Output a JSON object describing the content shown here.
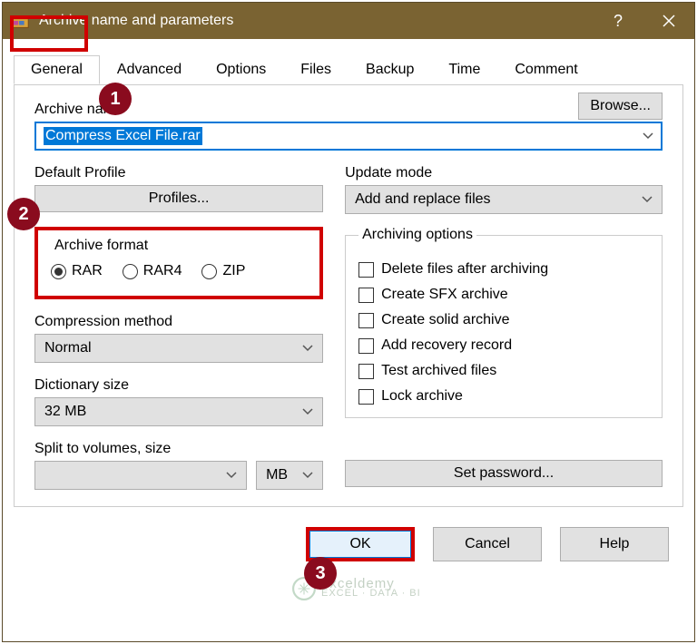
{
  "titlebar": {
    "title": "Archive name and parameters"
  },
  "tabs": [
    "General",
    "Advanced",
    "Options",
    "Files",
    "Backup",
    "Time",
    "Comment"
  ],
  "badges": {
    "b1": "1",
    "b2": "2",
    "b3": "3"
  },
  "general": {
    "archive_name_label": "Archive name",
    "browse": "Browse...",
    "filename": "Compress Excel File.rar",
    "default_profile_label": "Default Profile",
    "profiles_btn": "Profiles...",
    "update_mode_label": "Update mode",
    "update_mode_value": "Add and replace files",
    "archive_format_label": "Archive format",
    "formats": {
      "rar": "RAR",
      "rar4": "RAR4",
      "zip": "ZIP"
    },
    "compression_label": "Compression method",
    "compression_value": "Normal",
    "dict_label": "Dictionary size",
    "dict_value": "32 MB",
    "split_label": "Split to volumes, size",
    "split_unit": "MB",
    "archiving_options_label": "Archiving options",
    "opts": {
      "o1": "Delete files after archiving",
      "o2": "Create SFX archive",
      "o3": "Create solid archive",
      "o4": "Add recovery record",
      "o5": "Test archived files",
      "o6": "Lock archive"
    },
    "set_password": "Set password..."
  },
  "footer": {
    "ok": "OK",
    "cancel": "Cancel",
    "help": "Help"
  },
  "watermark": {
    "line1": "exceldemy",
    "line2": "EXCEL · DATA · BI"
  }
}
